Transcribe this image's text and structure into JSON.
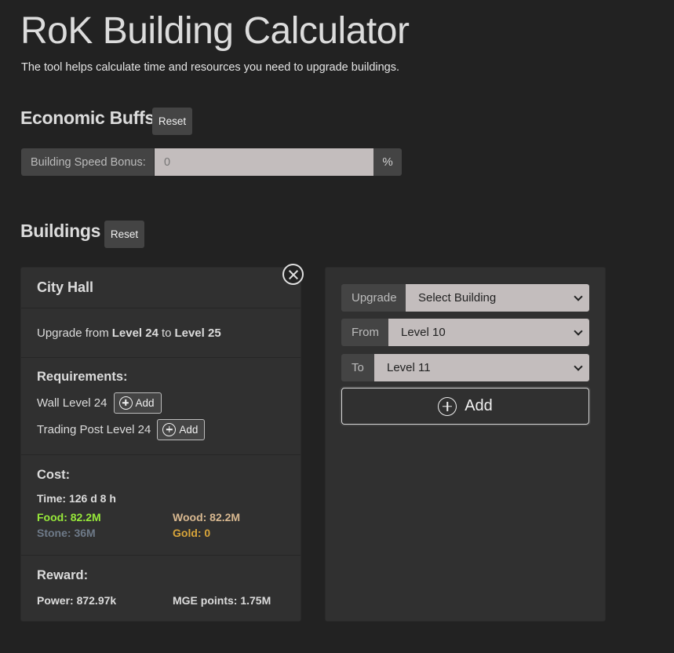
{
  "header": {
    "title": "RoK Building Calculator",
    "subtitle": "The tool helps calculate time and resources you need to upgrade buildings."
  },
  "economic_buffs": {
    "title": "Economic Buffs",
    "reset_label": "Reset",
    "speed_bonus_label": "Building Speed Bonus:",
    "speed_bonus_placeholder": "0",
    "speed_bonus_value": "",
    "speed_bonus_suffix": "%"
  },
  "buildings": {
    "title": "Buildings",
    "reset_label": "Reset",
    "cards": [
      {
        "name": "City Hall",
        "upgrade_prefix": "Upgrade from",
        "from_level": "Level 24",
        "to_word": "to",
        "to_level": "Level 25",
        "requirements_label": "Requirements:",
        "requirements": [
          {
            "text": "Wall Level 24",
            "button_label": "Add"
          },
          {
            "text": "Trading Post Level 24",
            "button_label": "Add"
          }
        ],
        "cost_label": "Cost:",
        "time": "Time: 126 d 8 h",
        "food": "Food: 82.2M",
        "wood": "Wood: 82.2M",
        "stone": "Stone: 36M",
        "gold": "Gold: 0",
        "reward_label": "Reward:",
        "power": "Power: 872.97k",
        "mge_points": "MGE points: 1.75M"
      }
    ]
  },
  "resource_colors": {
    "food": "#97e83a",
    "wood": "#d8b890",
    "stone": "#6e7a88",
    "gold": "#d8a53a"
  },
  "add_panel": {
    "upgrade_label": "Upgrade",
    "upgrade_selected": "Select Building",
    "from_label": "From",
    "from_selected": "Level 10",
    "to_label": "To",
    "to_selected": "Level 11",
    "add_label": "Add"
  }
}
